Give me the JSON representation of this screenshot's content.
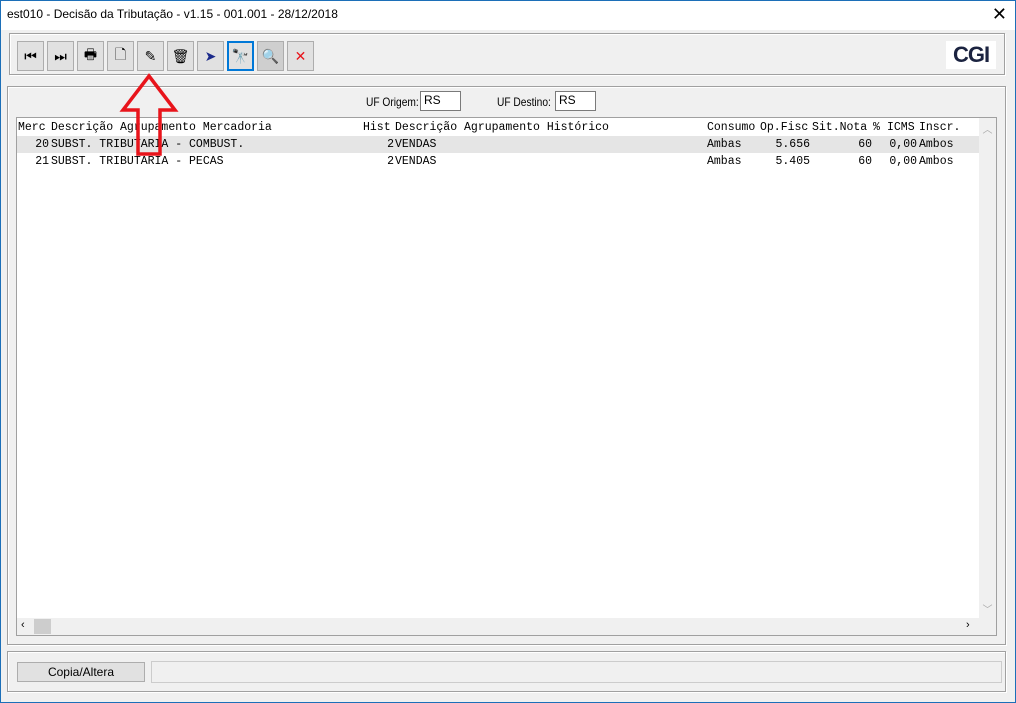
{
  "window": {
    "title": "est010 - Decisão da Tributação - v1.15 - 001.001 - 28/12/2018",
    "close": "✕"
  },
  "toolbar": {
    "buttons": [
      {
        "name": "first-record",
        "icon": "⏮"
      },
      {
        "name": "last-record",
        "icon": "⏭"
      },
      {
        "name": "print",
        "icon": "🖶"
      },
      {
        "name": "new",
        "icon": "🗋"
      },
      {
        "name": "edit",
        "icon": "✎"
      },
      {
        "name": "delete",
        "icon": "🗑"
      },
      {
        "name": "send",
        "icon": "➤"
      },
      {
        "name": "find",
        "icon": "🔭"
      },
      {
        "name": "zoom",
        "icon": "🔍"
      },
      {
        "name": "cancel",
        "icon": "✕"
      }
    ],
    "logo": "CGI"
  },
  "filters": {
    "uf_origem_label": "UF Origem:",
    "uf_origem": "RS",
    "uf_destino_label": "UF Destino:",
    "uf_destino": "RS"
  },
  "grid": {
    "columns": [
      "Merc",
      "Descrição Agrupamento Mercadoria",
      "Hist",
      "Descrição Agrupamento Histórico",
      "Consumo",
      "Op.Fisc",
      "Sit.Nota",
      "%",
      "ICMS",
      "Inscr."
    ],
    "rows": [
      [
        "20",
        "SUBST. TRIBUTARIA - COMBUST.",
        "2",
        "VENDAS",
        "Ambas",
        "5.656",
        "60",
        "0,00",
        "Ambos"
      ],
      [
        "21",
        "SUBST. TRIBUTARIA - PECAS",
        "2",
        "VENDAS",
        "Ambas",
        "5.405",
        "60",
        "0,00",
        "Ambos"
      ]
    ]
  },
  "footer": {
    "copy_button": "Copia/Altera",
    "status": ""
  },
  "colors": {
    "border": "#1c6fb8",
    "annotation": "#e8141b"
  }
}
